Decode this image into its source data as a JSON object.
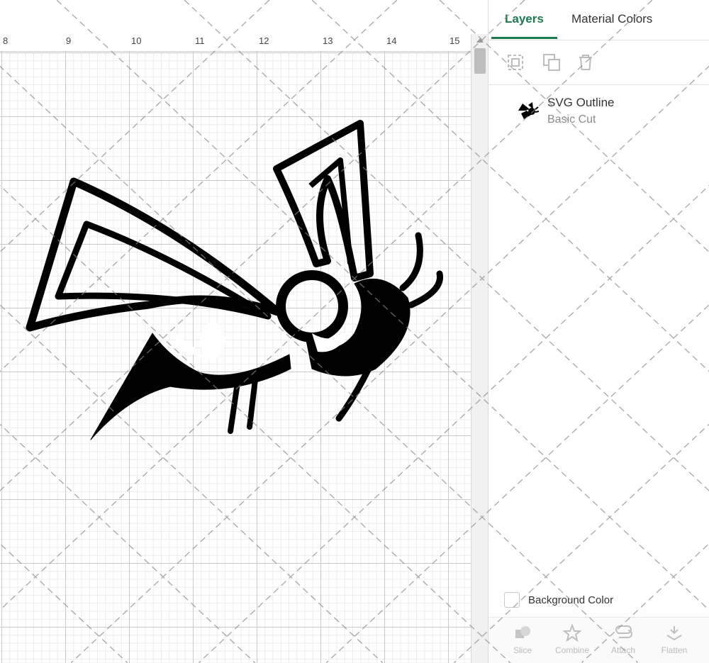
{
  "ruler": {
    "labels": [
      "8",
      "9",
      "10",
      "11",
      "12",
      "13",
      "14",
      "15"
    ]
  },
  "canvas": {
    "design_name": "hornet-design"
  },
  "panel": {
    "tabs": [
      {
        "label": "Layers",
        "active": true
      },
      {
        "label": "Material Colors",
        "active": false
      }
    ],
    "layer_actions": [
      "group-icon",
      "duplicate-icon",
      "trash-icon"
    ],
    "layer": {
      "name": "SVG Outline",
      "operation": "Basic Cut"
    },
    "background_color": {
      "label": "Background Color",
      "checked": false
    },
    "toolbar": [
      {
        "label": "Slice",
        "icon": "slice-icon"
      },
      {
        "label": "Combine",
        "icon": "combine-icon"
      },
      {
        "label": "Attach",
        "icon": "attach-icon"
      },
      {
        "label": "Flatten",
        "icon": "flatten-icon"
      }
    ]
  },
  "colors": {
    "accent": "#1c7a4d",
    "grid_major": "#c9c9c9",
    "grid_minor": "#ececec"
  }
}
